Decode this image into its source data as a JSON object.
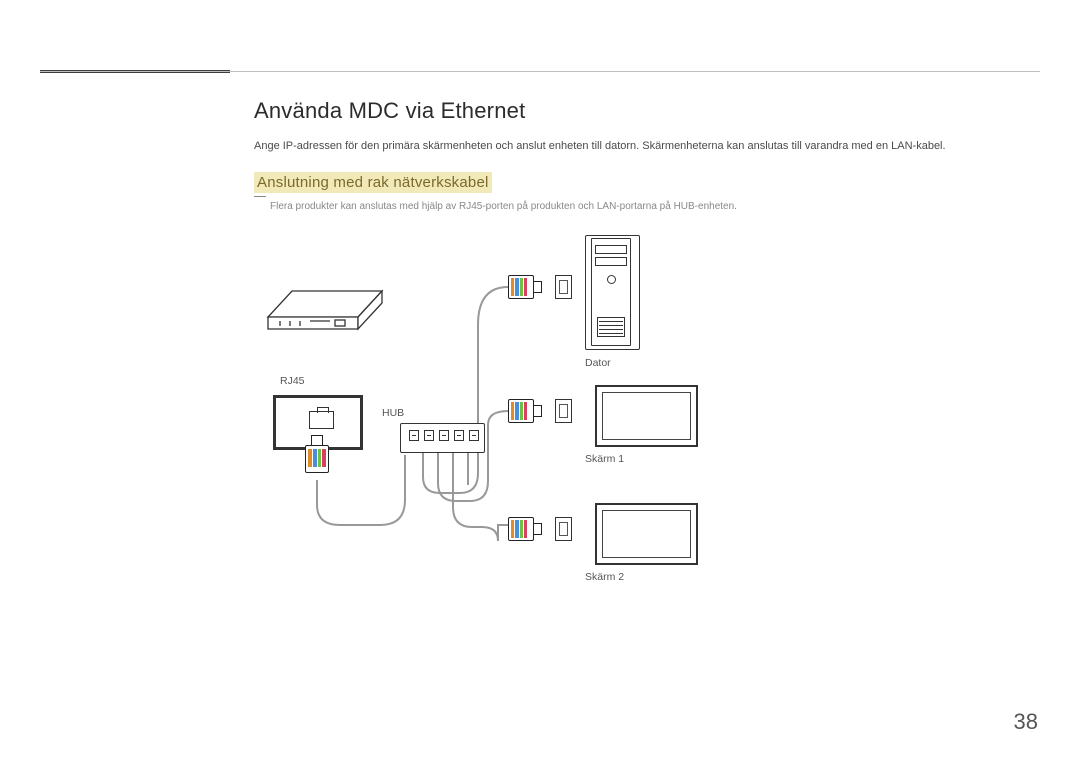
{
  "page": {
    "title": "Använda MDC via Ethernet",
    "intro": "Ange IP-adressen för den primära skärmenheten och anslut enheten till datorn. Skärmenheterna kan anslutas till varandra med en LAN-kabel.",
    "subheading": "Anslutning med rak nätverkskabel",
    "note": "Flera produkter kan anslutas med hjälp av RJ45-porten på produkten och LAN-portarna på HUB-enheten.",
    "number": "38"
  },
  "diagram": {
    "labels": {
      "rj45": "RJ45",
      "hub": "HUB",
      "computer": "Dator",
      "screen1": "Skärm 1",
      "screen2": "Skärm 2"
    }
  }
}
